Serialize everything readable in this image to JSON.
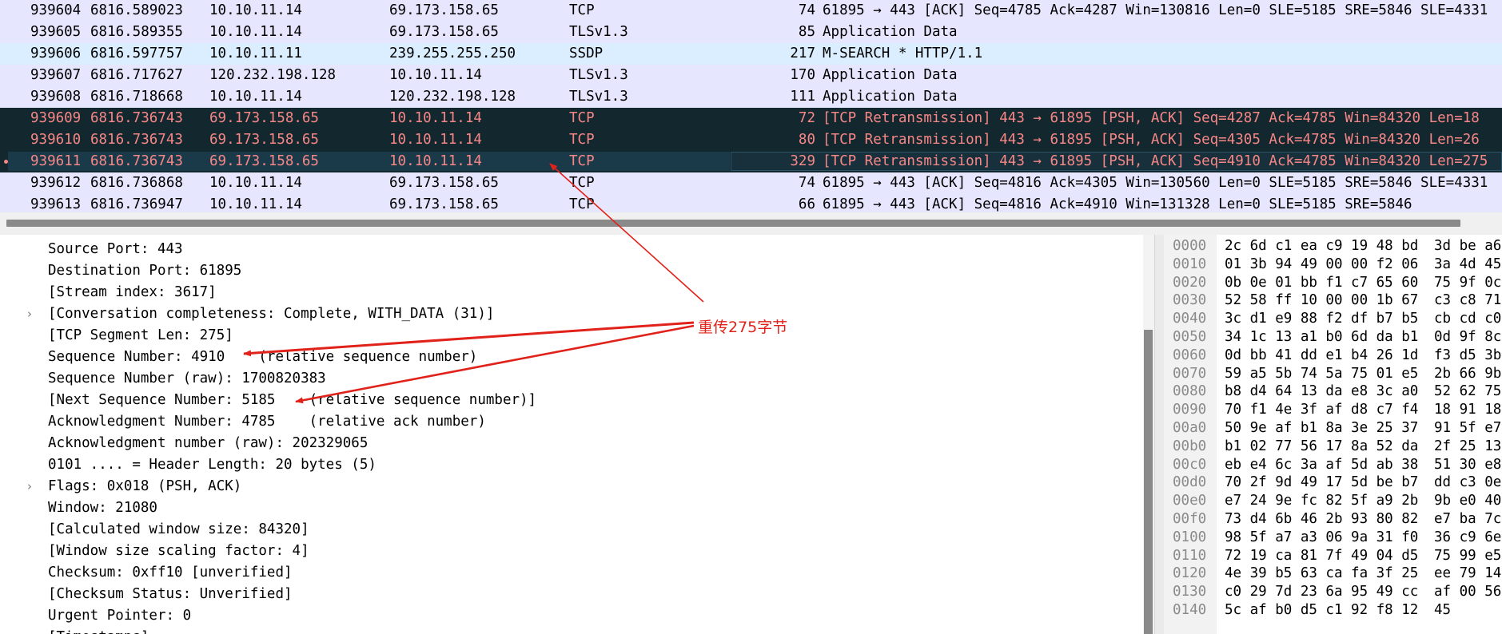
{
  "packets": [
    {
      "no": "939604",
      "time": "6816.589023",
      "src": "10.10.11.14",
      "dst": "69.173.158.65",
      "proto": "TCP",
      "len": "74",
      "info": "61895 → 443 [ACK] Seq=4785 Ack=4287 Win=130816 Len=0 SLE=5185 SRE=5846 SLE=4331"
    },
    {
      "no": "939605",
      "time": "6816.589355",
      "src": "10.10.11.14",
      "dst": "69.173.158.65",
      "proto": "TLSv1.3",
      "len": "85",
      "info": "Application Data"
    },
    {
      "no": "939606",
      "time": "6816.597757",
      "src": "10.10.11.11",
      "dst": "239.255.255.250",
      "proto": "SSDP",
      "len": "217",
      "info": "M-SEARCH * HTTP/1.1"
    },
    {
      "no": "939607",
      "time": "6816.717627",
      "src": "120.232.198.128",
      "dst": "10.10.11.14",
      "proto": "TLSv1.3",
      "len": "170",
      "info": "Application Data"
    },
    {
      "no": "939608",
      "time": "6816.718668",
      "src": "10.10.11.14",
      "dst": "120.232.198.128",
      "proto": "TLSv1.3",
      "len": "111",
      "info": "Application Data"
    },
    {
      "no": "939609",
      "time": "6816.736743",
      "src": "69.173.158.65",
      "dst": "10.10.11.14",
      "proto": "TCP",
      "len": "72",
      "info": "[TCP Retransmission] 443 → 61895 [PSH, ACK] Seq=4287 Ack=4785 Win=84320 Len=18"
    },
    {
      "no": "939610",
      "time": "6816.736743",
      "src": "69.173.158.65",
      "dst": "10.10.11.14",
      "proto": "TCP",
      "len": "80",
      "info": "[TCP Retransmission] 443 → 61895 [PSH, ACK] Seq=4305 Ack=4785 Win=84320 Len=26"
    },
    {
      "no": "939611",
      "time": "6816.736743",
      "src": "69.173.158.65",
      "dst": "10.10.11.14",
      "proto": "TCP",
      "len": "329",
      "info": "[TCP Retransmission] 443 → 61895 [PSH, ACK] Seq=4910 Ack=4785 Win=84320 Len=275"
    },
    {
      "no": "939612",
      "time": "6816.736868",
      "src": "10.10.11.14",
      "dst": "69.173.158.65",
      "proto": "TCP",
      "len": "74",
      "info": "61895 → 443 [ACK] Seq=4816 Ack=4305 Win=130560 Len=0 SLE=5185 SRE=5846 SLE=4331"
    },
    {
      "no": "939613",
      "time": "6816.736947",
      "src": "10.10.11.14",
      "dst": "69.173.158.65",
      "proto": "TCP",
      "len": "66",
      "info": "61895 → 443 [ACK] Seq=4816 Ack=4910 Win=131328 Len=0 SLE=5185 SRE=5846"
    }
  ],
  "details": [
    {
      "text": "Source Port: 443"
    },
    {
      "text": "Destination Port: 61895"
    },
    {
      "text": "[Stream index: 3617]"
    },
    {
      "text": "[Conversation completeness: Complete, WITH_DATA (31)]",
      "expand": "›"
    },
    {
      "text": "[TCP Segment Len: 275]"
    },
    {
      "text": "Sequence Number: 4910    (relative sequence number)"
    },
    {
      "text": "Sequence Number (raw): 1700820383"
    },
    {
      "text": "[Next Sequence Number: 5185    (relative sequence number)]"
    },
    {
      "text": "Acknowledgment Number: 4785    (relative ack number)"
    },
    {
      "text": "Acknowledgment number (raw): 202329065"
    },
    {
      "text": "0101 .... = Header Length: 20 bytes (5)"
    },
    {
      "text": "Flags: 0x018 (PSH, ACK)",
      "expand": "›"
    },
    {
      "text": "Window: 21080"
    },
    {
      "text": "[Calculated window size: 84320]"
    },
    {
      "text": "[Window size scaling factor: 4]"
    },
    {
      "text": "Checksum: 0xff10 [unverified]"
    },
    {
      "text": "[Checksum Status: Unverified]"
    },
    {
      "text": "Urgent Pointer: 0"
    },
    {
      "text": "[Timestamps]"
    }
  ],
  "hex": [
    {
      "off": "0000",
      "b1": "2c 6d c1 ea c9 19 48 bd",
      "b2": "3d be a6"
    },
    {
      "off": "0010",
      "b1": "01 3b 94 49 00 00 f2 06",
      "b2": "3a 4d 45"
    },
    {
      "off": "0020",
      "b1": "0b 0e 01 bb f1 c7 65 60",
      "b2": "75 9f 0c"
    },
    {
      "off": "0030",
      "b1": "52 58 ff 10 00 00 1b 67",
      "b2": "c3 c8 71"
    },
    {
      "off": "0040",
      "b1": "3c d1 e9 88 f2 df b7 b5",
      "b2": "cb cd c0"
    },
    {
      "off": "0050",
      "b1": "34 1c 13 a1 b0 6d da b1",
      "b2": "0d 9f 8c"
    },
    {
      "off": "0060",
      "b1": "0d bb 41 dd e1 b4 26 1d",
      "b2": "f3 d5 3b"
    },
    {
      "off": "0070",
      "b1": "59 a5 5b 74 5a 75 01 e5",
      "b2": "2b 66 9b"
    },
    {
      "off": "0080",
      "b1": "b8 d4 64 13 da e8 3c a0",
      "b2": "52 62 75"
    },
    {
      "off": "0090",
      "b1": "70 f1 4e 3f af d8 c7 f4",
      "b2": "18 91 18"
    },
    {
      "off": "00a0",
      "b1": "50 9e af b1 8a 3e 25 37",
      "b2": "91 5f e7"
    },
    {
      "off": "00b0",
      "b1": "b1 02 77 56 17 8a 52 da",
      "b2": "2f 25 13"
    },
    {
      "off": "00c0",
      "b1": "eb e4 6c 3a af 5d ab 38",
      "b2": "51 30 e8"
    },
    {
      "off": "00d0",
      "b1": "70 2f 9d 49 17 5d be b7",
      "b2": "dd c3 0e"
    },
    {
      "off": "00e0",
      "b1": "e7 24 9e fc 82 5f a9 2b",
      "b2": "9b e0 40"
    },
    {
      "off": "00f0",
      "b1": "73 d4 6b 46 2b 93 80 82",
      "b2": "e7 ba 7c"
    },
    {
      "off": "0100",
      "b1": "98 5f a7 a3 06 9a 31 f0",
      "b2": "36 c9 6e"
    },
    {
      "off": "0110",
      "b1": "72 19 ca 81 7f 49 04 d5",
      "b2": "75 99 e5"
    },
    {
      "off": "0120",
      "b1": "4e 39 b5 63 ca fa 3f 25",
      "b2": "ee 79 14"
    },
    {
      "off": "0130",
      "b1": "c0 29 7d 23 6a 95 49 cc",
      "b2": "af 00 56"
    },
    {
      "off": "0140",
      "b1": "5c af b0 d5 c1 92 f8 12",
      "b2": "45"
    }
  ],
  "annotation": {
    "label": "重传275字节"
  },
  "colors": {
    "tcp_row": "#e7e6ff",
    "udp_row": "#daeeff",
    "bad_row_bg": "#12272e",
    "bad_row_fg": "#f78787",
    "arrow": "#e0221a"
  }
}
